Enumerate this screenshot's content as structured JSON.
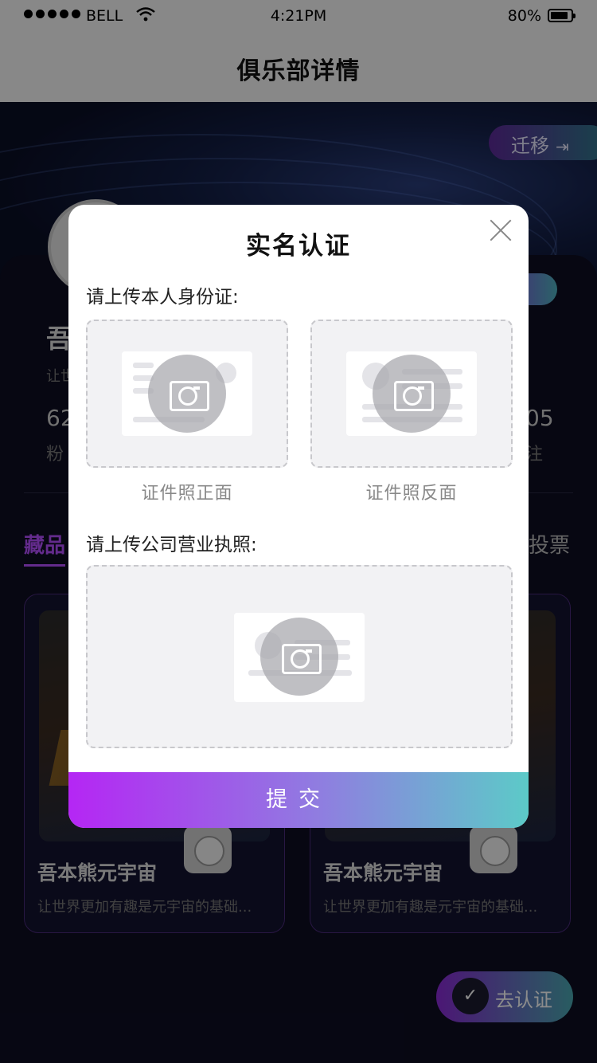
{
  "status_bar": {
    "carrier": "BELL",
    "time": "4:21PM",
    "battery": "80%"
  },
  "nav": {
    "title": "俱乐部详情"
  },
  "hero": {
    "migrate_label": "迁移"
  },
  "club": {
    "name": "吾",
    "desc": "让世",
    "stat_left_value": "62",
    "stat_left_label": "粉",
    "stat_right_value": "05",
    "stat_right_label": "注"
  },
  "tabs": {
    "collection": "藏品",
    "vote": "投票"
  },
  "nft_cards": [
    {
      "name": "吾本熊元宇宙",
      "desc": "让世界更加有趣是元宇宙的基础..."
    },
    {
      "name": "吾本熊元宇宙",
      "desc": "让世界更加有趣是元宇宙的基础..."
    }
  ],
  "go_verify": {
    "label": "去认证"
  },
  "modal": {
    "title": "实名认证",
    "id_label": "请上传本人身份证:",
    "id_front_caption": "证件照正面",
    "id_back_caption": "证件照反面",
    "license_label": "请上传公司营业执照:",
    "submit_label": "提交"
  },
  "colors": {
    "accent_purple": "#b526f4",
    "accent_teal": "#5ccac8",
    "tab_active": "#b44fff"
  },
  "icons": [
    "wifi-icon",
    "battery-icon",
    "migrate-icon",
    "close-icon",
    "camera-icon",
    "verify-icon"
  ]
}
